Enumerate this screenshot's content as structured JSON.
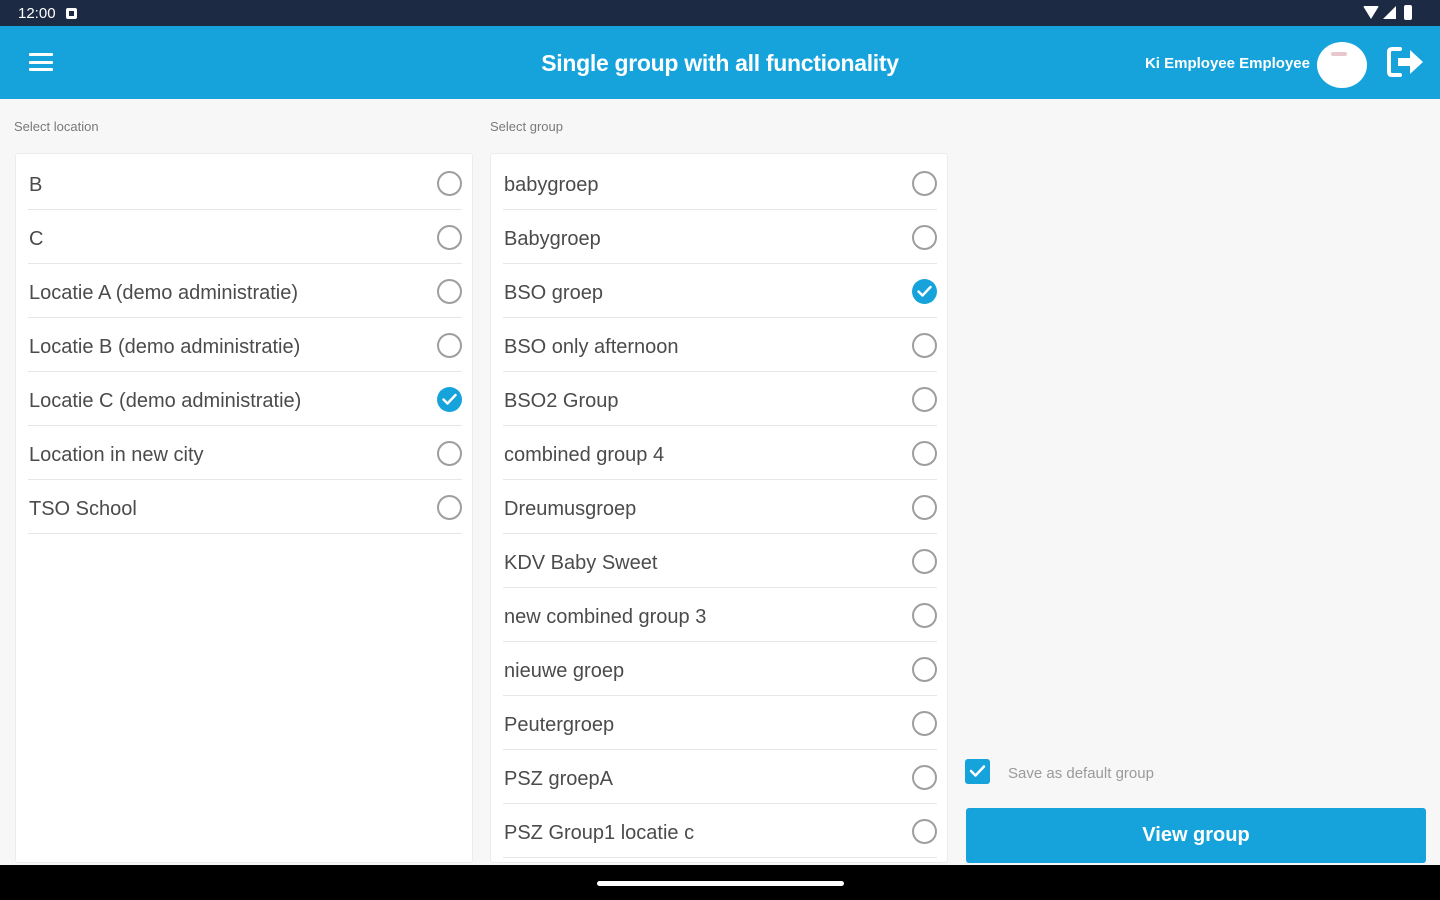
{
  "status_bar": {
    "time": "12:00"
  },
  "app_bar": {
    "title": "Single group with all functionality",
    "user_name": "Ki Employee Employee"
  },
  "locations": {
    "label": "Select location",
    "items": [
      {
        "label": "B",
        "selected": false
      },
      {
        "label": "C",
        "selected": false
      },
      {
        "label": "Locatie A (demo administratie)",
        "selected": false
      },
      {
        "label": "Locatie B (demo administratie)",
        "selected": false
      },
      {
        "label": "Locatie C (demo administratie)",
        "selected": true
      },
      {
        "label": "Location in new city",
        "selected": false
      },
      {
        "label": "TSO School",
        "selected": false
      }
    ]
  },
  "groups": {
    "label": "Select group",
    "items": [
      {
        "label": "babygroep",
        "selected": false
      },
      {
        "label": "Babygroep",
        "selected": false
      },
      {
        "label": "BSO groep",
        "selected": true
      },
      {
        "label": "BSO only afternoon",
        "selected": false
      },
      {
        "label": "BSO2 Group",
        "selected": false
      },
      {
        "label": "combined group 4",
        "selected": false
      },
      {
        "label": "Dreumusgroep",
        "selected": false
      },
      {
        "label": "KDV Baby Sweet",
        "selected": false
      },
      {
        "label": "new combined group 3",
        "selected": false
      },
      {
        "label": "nieuwe groep",
        "selected": false
      },
      {
        "label": "Peutergroep",
        "selected": false
      },
      {
        "label": "PSZ groepA",
        "selected": false
      },
      {
        "label": "PSZ Group1 locatie c",
        "selected": false
      }
    ]
  },
  "save_default": {
    "label": "Save as default group",
    "checked": true
  },
  "view_button": {
    "label": "View group"
  },
  "colors": {
    "accent": "#16a3dc",
    "status_bar": "#1d2a44"
  }
}
